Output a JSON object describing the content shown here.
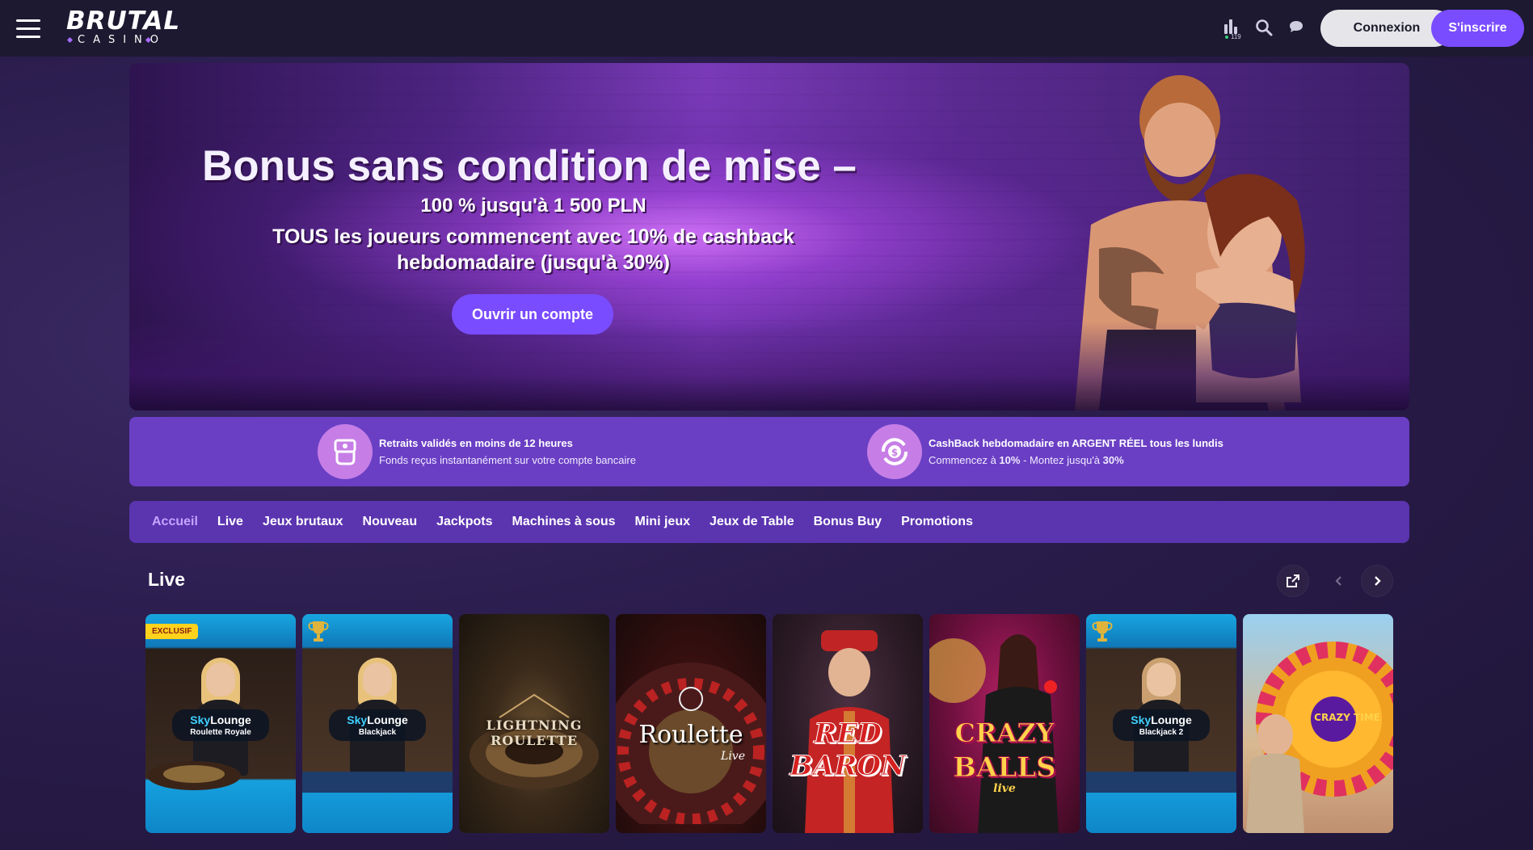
{
  "header": {
    "logo_main": "BRUTAL",
    "logo_sub": "CASINO",
    "stats_count": "119",
    "login_label": "Connexion",
    "signup_label": "S'inscrire"
  },
  "hero": {
    "title": "Bonus sans condition de mise –",
    "line1": "100 % jusqu'à 1 500 PLN",
    "line2": "TOUS les joueurs commencent avec 10% de cashback hebdomadaire (jusqu'à 30%)",
    "cta": "Ouvrir un compte"
  },
  "features": [
    {
      "title": "Retraits validés en moins de 12 heures",
      "subtitle": "Fonds reçus instantanément sur votre compte bancaire"
    },
    {
      "title": "CashBack hebdomadaire en ARGENT RÉEL tous les lundis",
      "subtitle_a": "Commencez à ",
      "subtitle_b": "10%",
      "subtitle_c": " - Montez jusqu'à ",
      "subtitle_d": "30%"
    }
  ],
  "nav": {
    "items": [
      "Accueil",
      "Live",
      "Jeux brutaux",
      "Nouveau",
      "Jackpots",
      "Machines à sous",
      "Mini jeux",
      "Jeux de Table",
      "Bonus Buy",
      "Promotions"
    ],
    "active": "Accueil"
  },
  "section": {
    "title": "Live"
  },
  "games": [
    {
      "badge": "EXCLUSIF",
      "brand_a": "Sky",
      "brand_b": "Lounge",
      "name": "Roulette Royale"
    },
    {
      "brand_a": "Sky",
      "brand_b": "Lounge",
      "name": "Blackjack"
    },
    {
      "name": "LIGHTNING ROULETTE"
    },
    {
      "name": "Roulette",
      "sub": "Live"
    },
    {
      "name_a": "RED",
      "name_b": "BARON"
    },
    {
      "name_a": "CRAZY",
      "name_b": "BALLS",
      "sub": "live"
    },
    {
      "brand_a": "Sky",
      "brand_b": "Lounge",
      "name": "Blackjack 2"
    },
    {
      "name": "CRAZY TIME"
    }
  ],
  "colors": {
    "accent": "#7a4cff",
    "features_bg": "#6a3fc4",
    "nav_bg": "#5b34b0",
    "nav_active": "#c3a6ff",
    "exclusive_badge": "#ffd21c"
  }
}
